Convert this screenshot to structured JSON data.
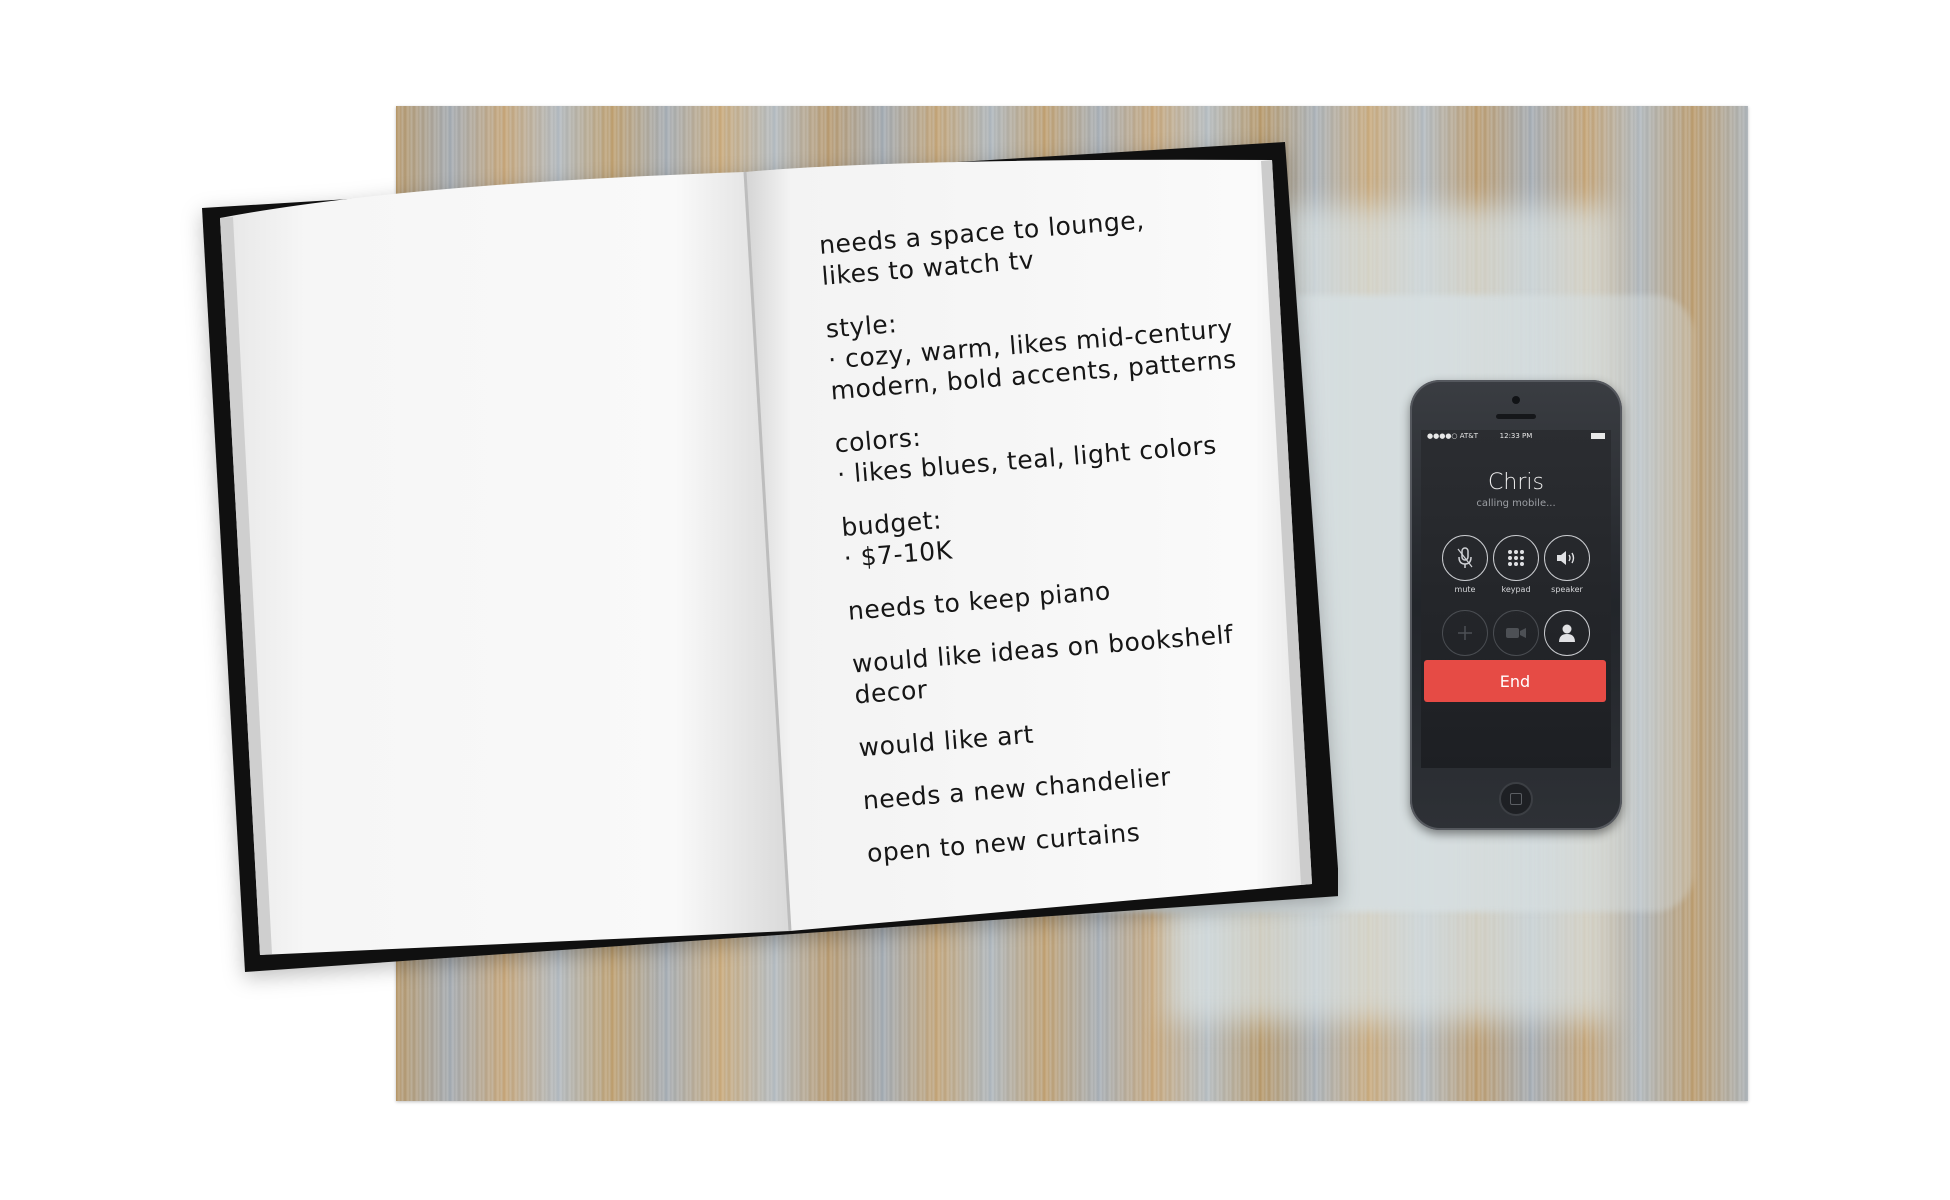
{
  "notebook": {
    "notes": [
      {
        "lines": [
          "needs a space to lounge,",
          "likes to watch tv"
        ]
      },
      {
        "lines": [
          "style:",
          "· cozy, warm, likes mid-century",
          "modern, bold accents, patterns"
        ]
      },
      {
        "lines": [
          "colors:",
          "· likes blues, teal, light colors"
        ]
      },
      {
        "lines": [
          "budget:",
          "· $7-10K"
        ]
      },
      {
        "lines": [
          "needs to keep piano"
        ]
      },
      {
        "lines": [
          "would like ideas on bookshelf",
          "decor"
        ]
      },
      {
        "lines": [
          "would like art"
        ]
      },
      {
        "lines": [
          "needs a new chandelier"
        ]
      },
      {
        "lines": [
          "open to new curtains"
        ]
      }
    ]
  },
  "phone": {
    "status": {
      "carrier": "●●●●○ AT&T",
      "time": "12:33 PM"
    },
    "caller_name": "Chris",
    "call_status": "calling mobile...",
    "buttons": [
      {
        "label": "mute",
        "icon": "microphone-icon"
      },
      {
        "label": "keypad",
        "icon": "keypad-icon"
      },
      {
        "label": "speaker",
        "icon": "speaker-icon"
      },
      {
        "label": "",
        "icon": "plus-icon"
      },
      {
        "label": "",
        "icon": "video-icon"
      },
      {
        "label": "contacts",
        "icon": "contact-icon"
      }
    ],
    "end_label": "End",
    "end_color": "#e64b45"
  },
  "placemat": {
    "colors": [
      "#b39363",
      "#a8b0b6",
      "#d6dee0"
    ]
  }
}
